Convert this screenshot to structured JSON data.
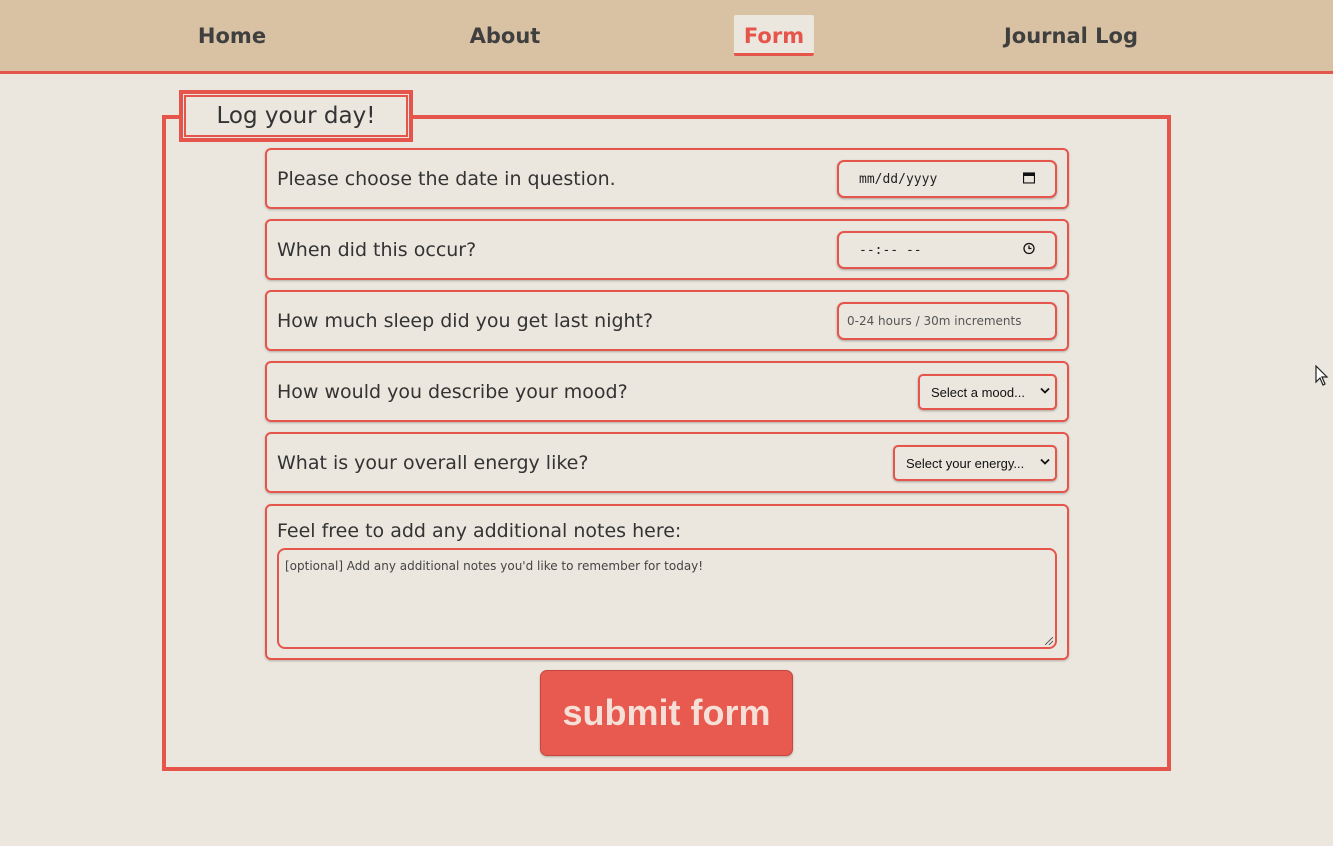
{
  "nav": {
    "items": [
      {
        "label": "Home",
        "active": false
      },
      {
        "label": "About",
        "active": false
      },
      {
        "label": "Form",
        "active": true
      },
      {
        "label": "Journal Log",
        "active": false
      }
    ]
  },
  "form": {
    "legend": "Log your day!",
    "date": {
      "question": "Please choose the date in question.",
      "placeholder": "mm/dd/yyyy"
    },
    "time": {
      "question": "When did this occur?",
      "placeholder": "--:-- --"
    },
    "sleep": {
      "question": "How much sleep did you get last night?",
      "placeholder": "0-24 hours / 30m increments"
    },
    "mood": {
      "question": "How would you describe your mood?",
      "selected": "Select a mood..."
    },
    "energy": {
      "question": "What is your overall energy like?",
      "selected": "Select your energy..."
    },
    "notes": {
      "question": "Feel free to add any additional notes here:",
      "placeholder": "[optional] Add any additional notes you'd like to remember for today!"
    },
    "submit_label": "submit form"
  },
  "colors": {
    "accent": "#e5554c",
    "nav_bg": "#d9c2a3",
    "page_bg": "#ebe7de"
  },
  "icons": {
    "date": "calendar-icon",
    "time": "clock-icon",
    "select": "chevron-down-icon"
  }
}
